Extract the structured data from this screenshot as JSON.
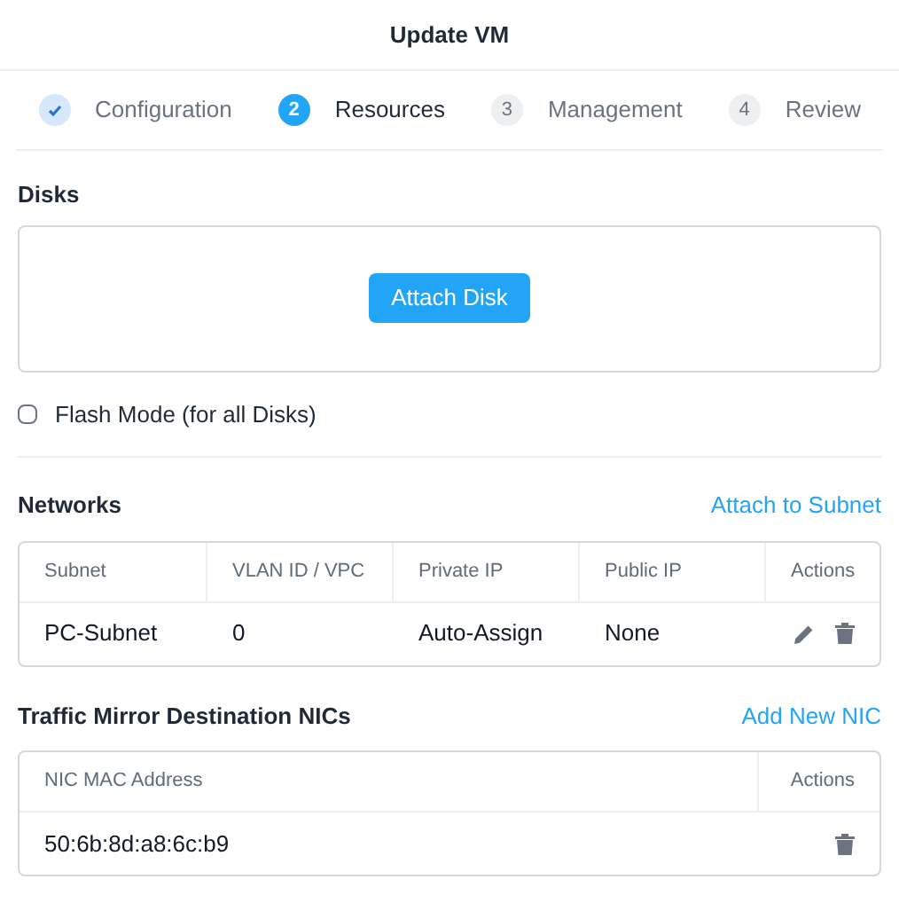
{
  "title": "Update VM",
  "steps": [
    {
      "label": "Configuration",
      "kind": "done",
      "selected": false
    },
    {
      "number": "2",
      "label": "Resources",
      "kind": "current",
      "selected": true
    },
    {
      "number": "3",
      "label": "Management",
      "kind": "pending",
      "selected": false
    },
    {
      "number": "4",
      "label": "Review",
      "kind": "pending",
      "selected": false
    }
  ],
  "disks": {
    "heading": "Disks",
    "button": "Attach Disk"
  },
  "flash_mode": {
    "label": "Flash Mode (for all Disks)",
    "checked": false
  },
  "networks": {
    "heading": "Networks",
    "link": "Attach to Subnet",
    "columns": [
      "Subnet",
      "VLAN ID / VPC",
      "Private IP",
      "Public IP",
      "Actions"
    ],
    "rows": [
      {
        "cells": [
          "PC-Subnet",
          "0",
          "Auto-Assign",
          "None"
        ]
      }
    ]
  },
  "nics": {
    "heading": "Traffic Mirror Destination NICs",
    "link": "Add New NIC",
    "columns": [
      "NIC MAC Address",
      "Actions"
    ],
    "rows": [
      {
        "cells": [
          "50:6b:8d:a8:6c:b9"
        ]
      }
    ]
  }
}
